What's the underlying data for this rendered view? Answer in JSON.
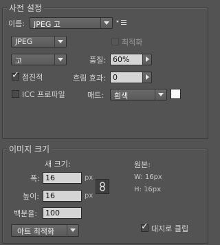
{
  "preset": {
    "legend": "사전 설정",
    "name_label": "이름:",
    "name_value": "JPEG 고",
    "format_value": "JPEG",
    "optimize_label": "최적화",
    "quality_preset_value": "고",
    "quality_label": "품질:",
    "quality_value": "60%",
    "progressive_label": "점진적",
    "blur_label": "흐림 효과:",
    "blur_value": "0",
    "icc_label": "ICC 프로파일",
    "matte_label": "매트:",
    "matte_value": "흰색",
    "matte_color": "#ffffff"
  },
  "image_size": {
    "legend": "이미지 크기",
    "new_size_label": "새 크기:",
    "width_label": "폭:",
    "width_value": "16",
    "height_label": "높이:",
    "height_value": "16",
    "percent_label": "백분율:",
    "percent_value": "100",
    "unit_px": "px",
    "original_label": "원본:",
    "orig_w": "W:  16px",
    "orig_h": "H:  16px",
    "resample_value": "아트 최적화",
    "clip_label": "대지로 클립"
  }
}
